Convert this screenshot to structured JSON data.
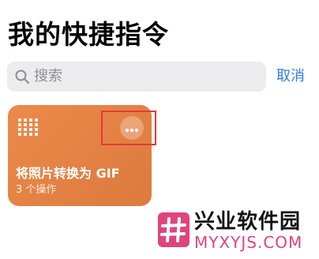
{
  "header": {
    "title": "我的快捷指令"
  },
  "search": {
    "placeholder": "搜索",
    "icon": "search-icon",
    "cancel_label": "取消"
  },
  "shortcuts": [
    {
      "title": "将照片转换为 GIF",
      "subtitle": "3 个操作",
      "icon": "grid-icon",
      "color": "#e4834a",
      "more_icon": "ellipsis-icon"
    }
  ],
  "watermark": {
    "name": "兴业软件园",
    "domain": "MYXYJS.COM"
  },
  "colors": {
    "accent": "#2b7de9",
    "highlight": "#e53935",
    "watermark_pink": "#e0447d"
  }
}
